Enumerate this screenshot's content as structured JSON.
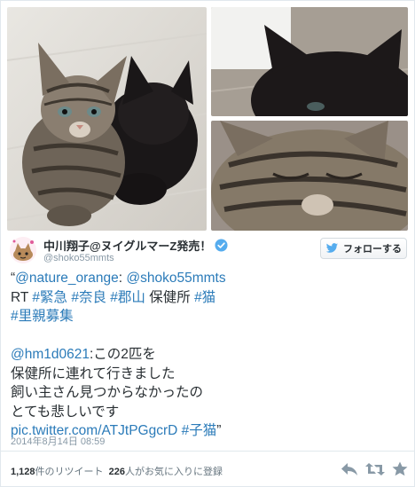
{
  "author": {
    "display_name": "中川翔子@ヌイグルマーZ発売！",
    "handle": "@shoko55mmts"
  },
  "follow_button": {
    "label": "フォローする"
  },
  "tweet": {
    "open_quote": "“",
    "mention1": "@nature_orange",
    "colon": ": ",
    "mention2": "@shoko55mmts",
    "rt": "RT ",
    "tag1": "#緊急",
    "tag2": "#奈良",
    "tag3": "#郡山",
    "word": "保健所",
    "tag4": "#猫",
    "tag5": "#里親募集",
    "mention3": "@hm1d0621",
    "line3": ":この2匹を",
    "line4": "保健所に連れて行きました",
    "line5": "飼い主さん見つからなかったの",
    "line6": "とても悲しいです",
    "link": "pic.twitter.com/ATJtPGgcrD",
    "tag6": "#子猫",
    "close_quote": "”"
  },
  "timestamp": "2014年8月14日 08:59",
  "stats": {
    "retweets": "1,128",
    "retweets_label": "件のリツイート",
    "favorites": "226",
    "favorites_label": "人がお気に入りに登録"
  },
  "colors": {
    "link": "#2b7bb9",
    "verified": "#55acee",
    "twitter_bird": "#55acee",
    "text": "#292f33",
    "muted": "#8899a6"
  },
  "icons": [
    "verified-icon",
    "twitter-bird-icon",
    "reply-icon",
    "retweet-icon",
    "favorite-icon"
  ]
}
